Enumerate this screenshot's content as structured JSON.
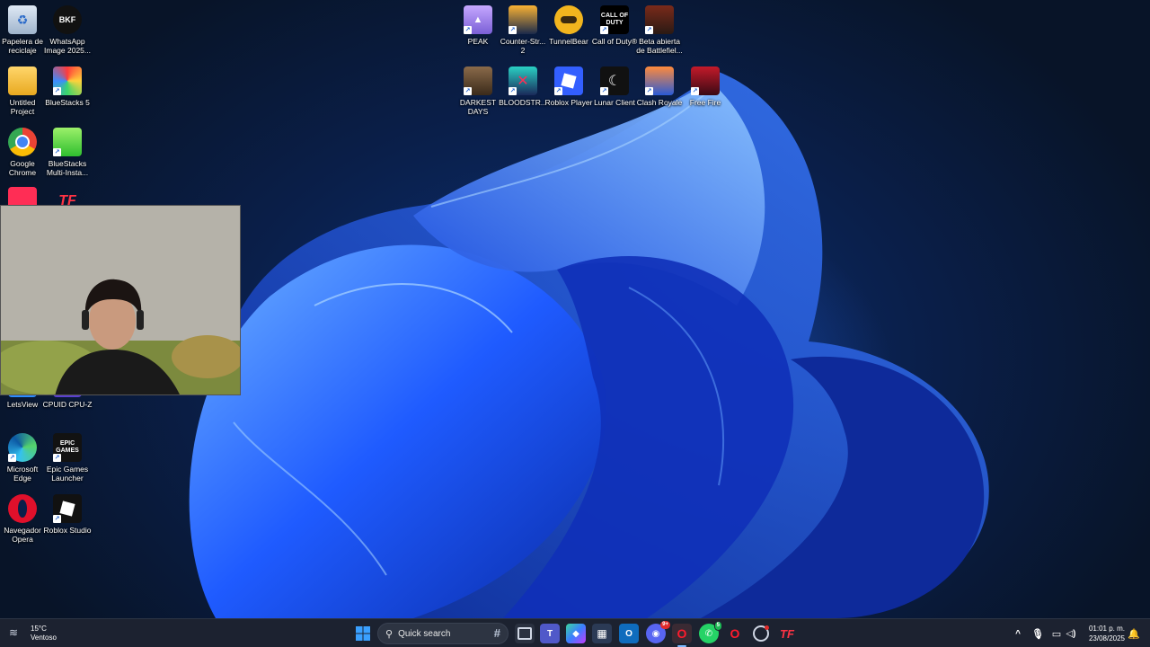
{
  "desktop": {
    "left_column": [
      {
        "name": "recycle-bin-icon",
        "label": "Papelera de reciclaje"
      },
      {
        "name": "whatsapp-image-icon",
        "label": "WhatsApp Image 2025..."
      },
      {
        "name": "folder-icon",
        "label": "Untitled Project"
      },
      {
        "name": "bluestacks-icon",
        "label": "BlueStacks 5"
      },
      {
        "name": "chrome-icon",
        "label": "Google Chrome"
      },
      {
        "name": "bluestacks-multi-icon",
        "label": "BlueStacks Multi-Insta..."
      },
      {
        "name": "letsview-icon",
        "label": "LetsView"
      },
      {
        "name": "cpuz-icon",
        "label": "CPUID CPU-Z"
      },
      {
        "name": "edge-icon",
        "label": "Microsoft Edge"
      },
      {
        "name": "epic-games-icon",
        "label": "Epic Games Launcher"
      },
      {
        "name": "opera-icon",
        "label": "Navegador Opera"
      },
      {
        "name": "roblox-studio-icon",
        "label": "Roblox Studio"
      }
    ],
    "top_row": [
      {
        "name": "peak-icon",
        "label": "PEAK"
      },
      {
        "name": "counter-strike-icon",
        "label": "Counter-Str... 2"
      },
      {
        "name": "tunnelbear-icon",
        "label": "TunnelBear"
      },
      {
        "name": "call-of-duty-icon",
        "label": "Call of Duty®"
      },
      {
        "name": "battlefield-icon",
        "label": "Beta abierta de Battlefiel..."
      }
    ],
    "second_row": [
      {
        "name": "darkest-days-icon",
        "label": "DARKEST DAYS"
      },
      {
        "name": "bloodstrike-icon",
        "label": "BLOODSTR..."
      },
      {
        "name": "roblox-player-icon",
        "label": "Roblox Player"
      },
      {
        "name": "lunar-client-icon",
        "label": "Lunar Client"
      },
      {
        "name": "clash-royale-icon",
        "label": "Clash Royale"
      },
      {
        "name": "free-fire-icon",
        "label": "Free Fire"
      }
    ],
    "glyph_text": {
      "whatsapp": "BKF",
      "cod": "CALL OF DUTY",
      "epic": "EPIC GAMES",
      "te": "TF"
    }
  },
  "taskbar": {
    "weather_temp": "15°C",
    "weather_desc": "Ventoso",
    "search_placeholder": "Quick search",
    "time": "01:01 p. m.",
    "date": "23/08/2025",
    "discord_badge": "9+",
    "whatsapp_badge": "5"
  },
  "colors": {
    "accent": "#1a5fd1",
    "taskbar_bg": "#1c2230"
  }
}
